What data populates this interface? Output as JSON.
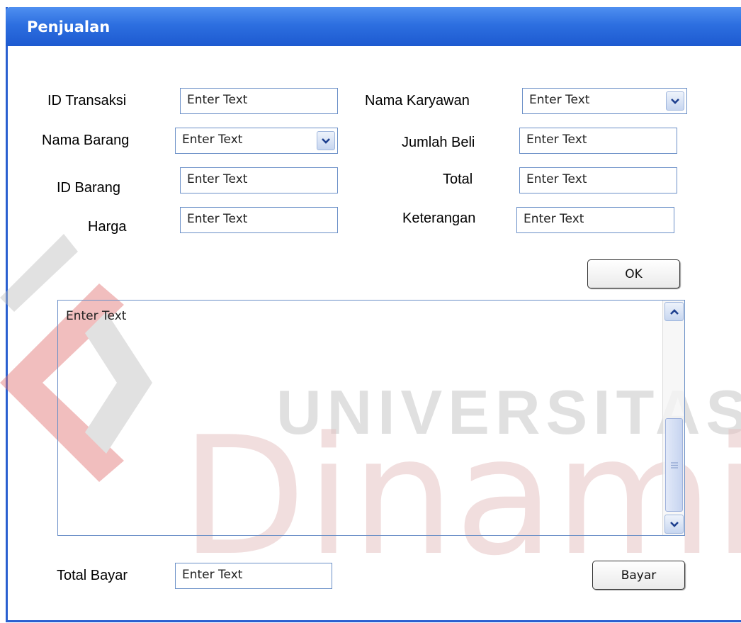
{
  "window": {
    "title": "Penjualan"
  },
  "watermark": {
    "line1": "UNIVERSITAS",
    "line2": "Dinamika"
  },
  "form": {
    "id_transaksi": {
      "label": "ID Transaksi",
      "value": "Enter Text"
    },
    "nama_barang": {
      "label": "Nama Barang",
      "value": "Enter Text"
    },
    "id_barang": {
      "label": "ID Barang",
      "value": "Enter Text"
    },
    "harga": {
      "label": "Harga",
      "value": "Enter Text"
    },
    "nama_karyawan": {
      "label": "Nama Karyawan",
      "value": "Enter Text"
    },
    "jumlah_beli": {
      "label": "Jumlah Beli",
      "value": "Enter Text"
    },
    "total": {
      "label": "Total",
      "value": "Enter Text"
    },
    "keterangan": {
      "label": "Keterangan",
      "value": "Enter Text"
    }
  },
  "buttons": {
    "ok": "OK",
    "bayar": "Bayar"
  },
  "list": {
    "text": "Enter Text"
  },
  "footer": {
    "total_bayar_label": "Total Bayar",
    "total_bayar_value": "Enter Text"
  },
  "colors": {
    "titlebar": "#2d6fe0",
    "field_border": "#6a8fc7",
    "watermark_red": "#e8a0a0",
    "watermark_gray": "#d0d0d0"
  },
  "icons": {
    "dropdown": "chevron-down-icon",
    "scroll_up": "chevron-up-icon",
    "scroll_down": "chevron-down-icon",
    "grip": "grip-lines-icon"
  }
}
